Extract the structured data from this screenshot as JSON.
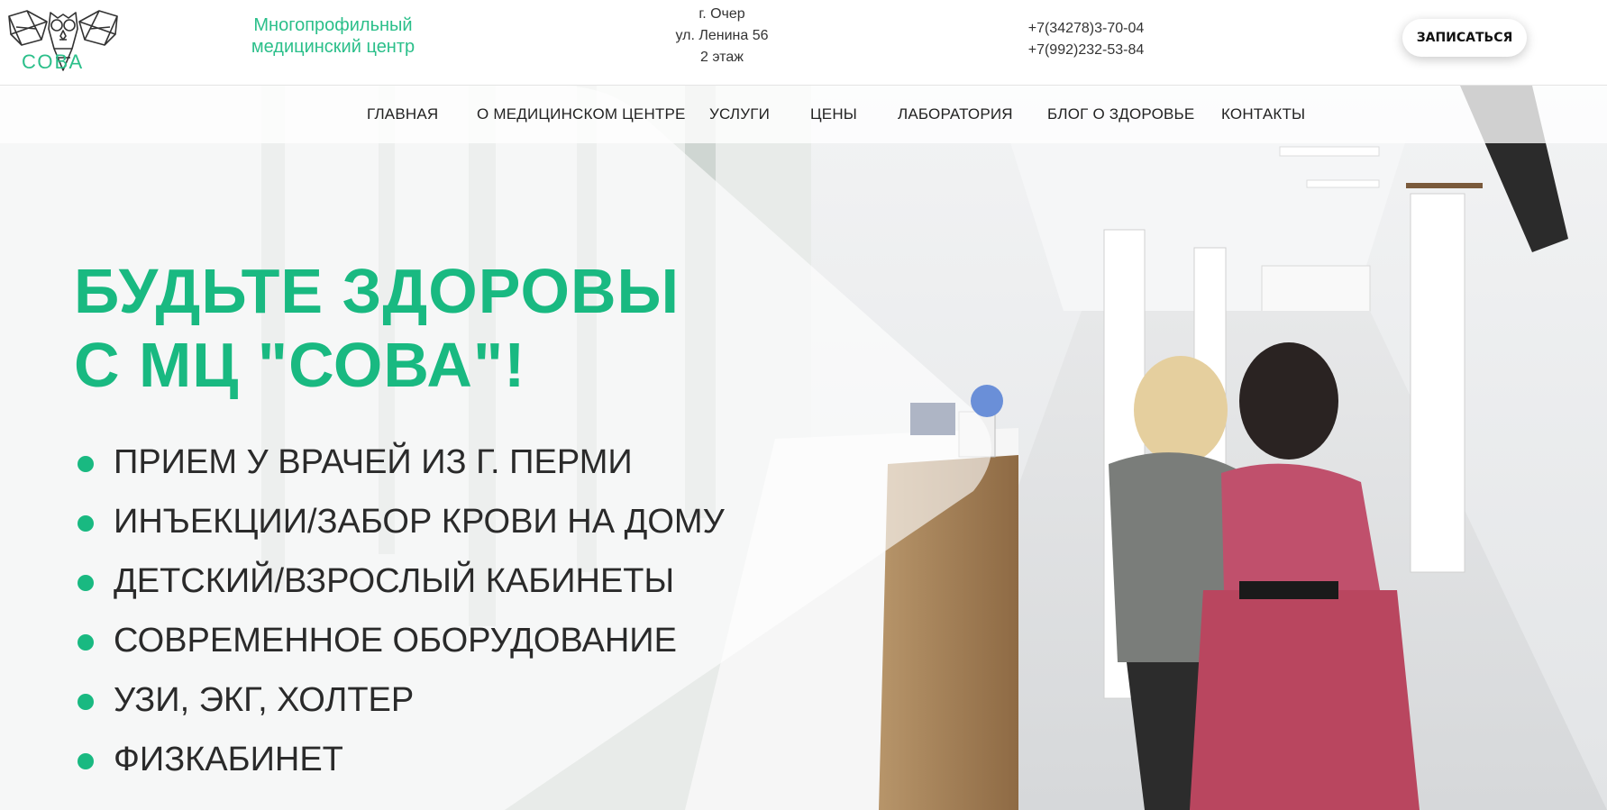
{
  "brand": {
    "logo_text": "СОВА",
    "tagline": "Многопрофильный медицинский центр",
    "accent_color": "#19b981"
  },
  "address": {
    "city": "г. Очер",
    "street": "ул. Ленина 56",
    "floor": "2 этаж"
  },
  "phones": [
    "+7(34278)3-70-04",
    "+7(992)232-53-84"
  ],
  "header": {
    "cta_label": "ЗАПИСАТЬСЯ"
  },
  "nav": {
    "items": [
      "ГЛАВНАЯ",
      "О МЕДИЦИНСКОМ ЦЕНТРЕ",
      "УСЛУГИ",
      "ЦЕНЫ",
      "ЛАБОРАТОРИЯ",
      "БЛОГ О ЗДОРОВЬЕ",
      "КОНТАКТЫ"
    ]
  },
  "hero": {
    "headline_line1": "БУДЬТЕ ЗДОРОВЫ",
    "headline_line2": "С МЦ \"СОВА\"!",
    "bullets": [
      "ПРИЕМ У ВРАЧЕЙ ИЗ Г. ПЕРМИ",
      "ИНЪЕКЦИИ/ЗАБОР КРОВИ НА ДОМУ",
      "ДЕТСКИЙ/ВЗРОСЛЫЙ КАБИНЕТЫ",
      "СОВРЕМЕННОЕ ОБОРУДОВАНИЕ",
      "УЗИ, ЭКГ, ХОЛТЕР",
      "ФИЗКАБИНЕТ"
    ]
  }
}
